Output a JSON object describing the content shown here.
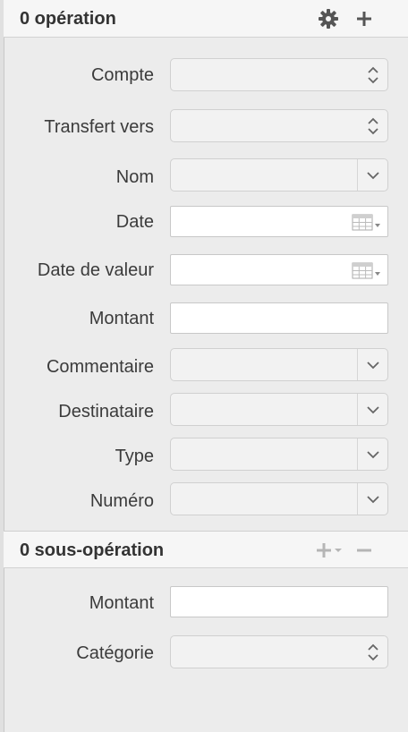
{
  "operation_header": {
    "title": "0 opération"
  },
  "fields": {
    "compte": {
      "label": "Compte",
      "value": ""
    },
    "transfert": {
      "label": "Transfert vers",
      "value": ""
    },
    "nom": {
      "label": "Nom",
      "value": ""
    },
    "date": {
      "label": "Date",
      "value": ""
    },
    "date_valeur": {
      "label": "Date de valeur",
      "value": ""
    },
    "montant": {
      "label": "Montant",
      "value": ""
    },
    "commentaire": {
      "label": "Commentaire",
      "value": ""
    },
    "destinataire": {
      "label": "Destinataire",
      "value": ""
    },
    "type": {
      "label": "Type",
      "value": ""
    },
    "numero": {
      "label": "Numéro",
      "value": ""
    }
  },
  "sub_header": {
    "title": "0 sous-opération"
  },
  "sub_fields": {
    "montant": {
      "label": "Montant",
      "value": ""
    },
    "categorie": {
      "label": "Catégorie",
      "value": ""
    }
  },
  "icons": {
    "settings": "gear-icon",
    "add": "plus-icon",
    "sub_add": "plus-dropdown-icon",
    "sub_remove": "minus-icon"
  }
}
